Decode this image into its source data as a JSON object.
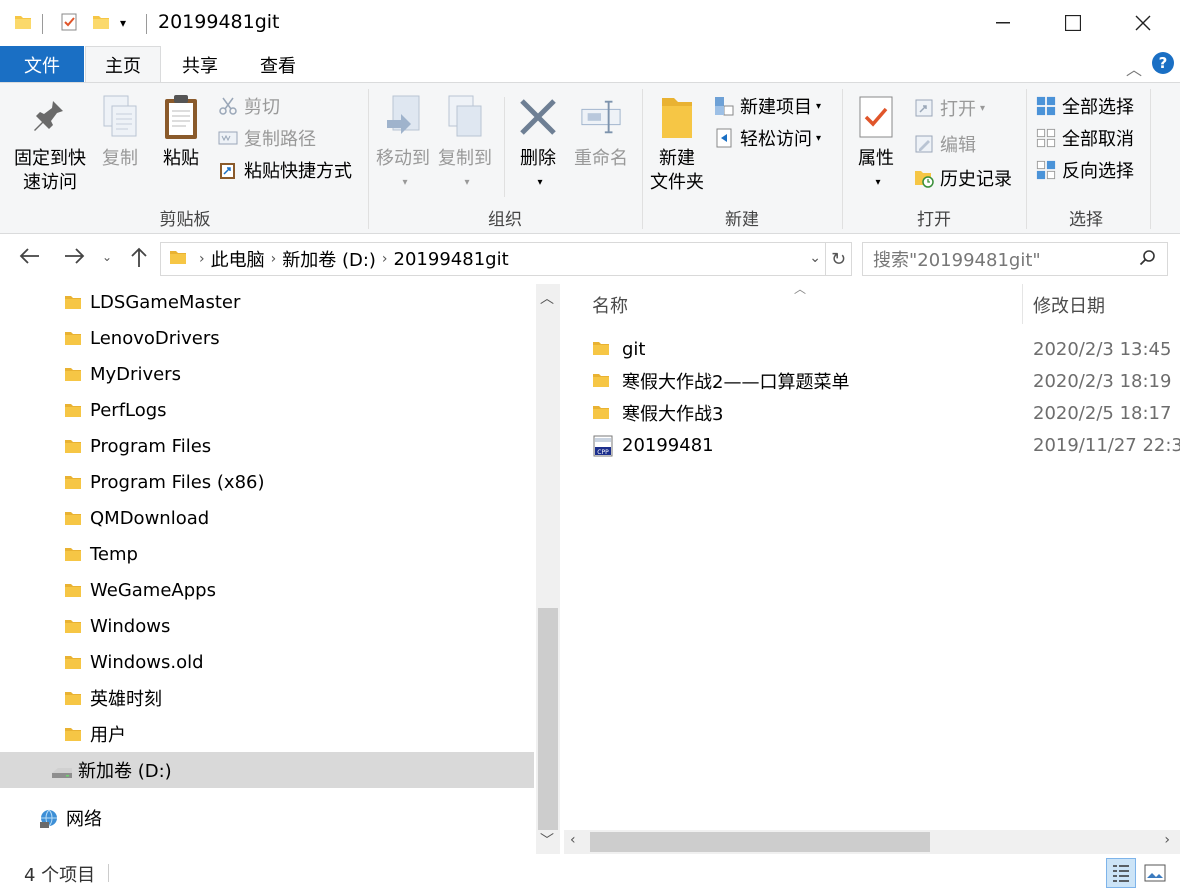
{
  "window": {
    "title": "20199481git"
  },
  "ribbon_tabs": {
    "file": "文件",
    "home": "主页",
    "share": "共享",
    "view": "查看"
  },
  "clipboard": {
    "pin_line1": "固定到快",
    "pin_line2": "速访问",
    "copy": "复制",
    "paste": "粘贴",
    "cut": "剪切",
    "copy_path": "复制路径",
    "paste_shortcut": "粘贴快捷方式",
    "group_label": "剪贴板"
  },
  "organize": {
    "move_to": "移动到",
    "copy_to": "复制到",
    "delete": "删除",
    "rename": "重命名",
    "group_label": "组织"
  },
  "new_group": {
    "new_folder_line1": "新建",
    "new_folder_line2": "文件夹",
    "new_item": "新建项目",
    "easy_access": "轻松访问",
    "group_label": "新建"
  },
  "open_group": {
    "properties": "属性",
    "open": "打开",
    "edit": "编辑",
    "history": "历史记录",
    "group_label": "打开"
  },
  "select_group": {
    "select_all": "全部选择",
    "select_none": "全部取消",
    "invert": "反向选择",
    "group_label": "选择"
  },
  "address": {
    "crumbs": [
      "此电脑",
      "新加卷 (D:)",
      "20199481git"
    ]
  },
  "search": {
    "placeholder": "搜索\"20199481git\""
  },
  "nav_tree": [
    "LDSGameMaster",
    "LenovoDrivers",
    "MyDrivers",
    "PerfLogs",
    "Program Files",
    "Program Files (x86)",
    "QMDownload",
    "Temp",
    "WeGameApps",
    "Windows",
    "Windows.old",
    "英雄时刻",
    "用户"
  ],
  "nav_drive": "新加卷 (D:)",
  "nav_network": "网络",
  "columns": {
    "name": "名称",
    "modified": "修改日期"
  },
  "files": [
    {
      "name": "git",
      "date": "2020/2/3 13:45",
      "type": "folder"
    },
    {
      "name": "寒假大作战2——口算题菜单",
      "date": "2020/2/3 18:19",
      "type": "folder"
    },
    {
      "name": "寒假大作战3",
      "date": "2020/2/5 18:17",
      "type": "folder"
    },
    {
      "name": "20199481",
      "date": "2019/11/27 22:3",
      "type": "cpp"
    }
  ],
  "status": {
    "count": "4 个项目"
  },
  "colors": {
    "accent": "#1a6fc4",
    "folder": "#f6c645",
    "selected_bg": "#d9d9d9"
  }
}
